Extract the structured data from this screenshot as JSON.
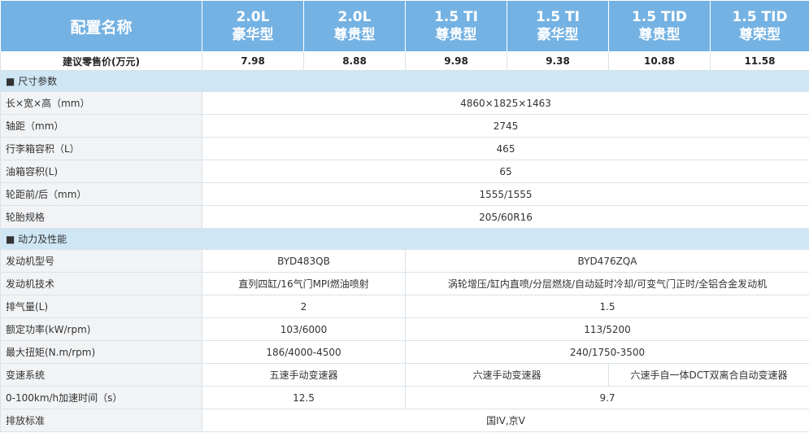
{
  "header": {
    "label": "配置名称",
    "models": [
      {
        "l1": "2.0L",
        "l2": "豪华型"
      },
      {
        "l1": "2.0L",
        "l2": "尊贵型"
      },
      {
        "l1": "1.5 TI",
        "l2": "尊贵型"
      },
      {
        "l1": "1.5 TI",
        "l2": "豪华型"
      },
      {
        "l1": "1.5 TID",
        "l2": "尊贵型"
      },
      {
        "l1": "1.5 TID",
        "l2": "尊荣型"
      }
    ]
  },
  "price": {
    "label": "建议零售价(万元)",
    "values": [
      "7.98",
      "8.88",
      "9.98",
      "9.38",
      "10.88",
      "11.58"
    ]
  },
  "sections": [
    {
      "title": "■ 尺寸参数",
      "rows": [
        {
          "label": "长×宽×高（mm）",
          "value": "4860×1825×1463"
        },
        {
          "label": "轴距（mm）",
          "value": "2745"
        },
        {
          "label": "行李箱容积（L）",
          "value": "465"
        },
        {
          "label": "油箱容积(L)",
          "value": "65"
        },
        {
          "label": "轮距前/后（mm）",
          "value": "1555/1555"
        },
        {
          "label": "轮胎规格",
          "value": "205/60R16"
        }
      ]
    },
    {
      "title": "■ 动力及性能",
      "rows": [
        {
          "label": "发动机型号",
          "v20": "BYD483QB",
          "v15": "BYD476ZQA"
        },
        {
          "label": "发动机技术",
          "v20": "直列四缸/16气门MPI燃油喷射",
          "v15": "涡轮增压/缸内直喷/分层燃烧/自动延时冷却/可变气门正时/全铝合金发动机"
        },
        {
          "label": "排气量(L)",
          "v20": "2",
          "v15": "1.5"
        },
        {
          "label": "额定功率(kW/rpm)",
          "v20": "103/6000",
          "v15": "113/5200"
        },
        {
          "label": "最大扭矩(N.m/rpm)",
          "v20": "186/4000-4500",
          "v15": "240/1750-3500"
        },
        {
          "label": "变速系统",
          "v20": "五速手动变速器",
          "vti": "六速手动变速器",
          "vtid": "六速手自一体DCT双离合自动变速器"
        },
        {
          "label": "0-100km/h加速时间（s）",
          "v20": "12.5",
          "v15": "9.7"
        },
        {
          "label": "排放标准",
          "value": "国IV,京V"
        }
      ]
    }
  ]
}
